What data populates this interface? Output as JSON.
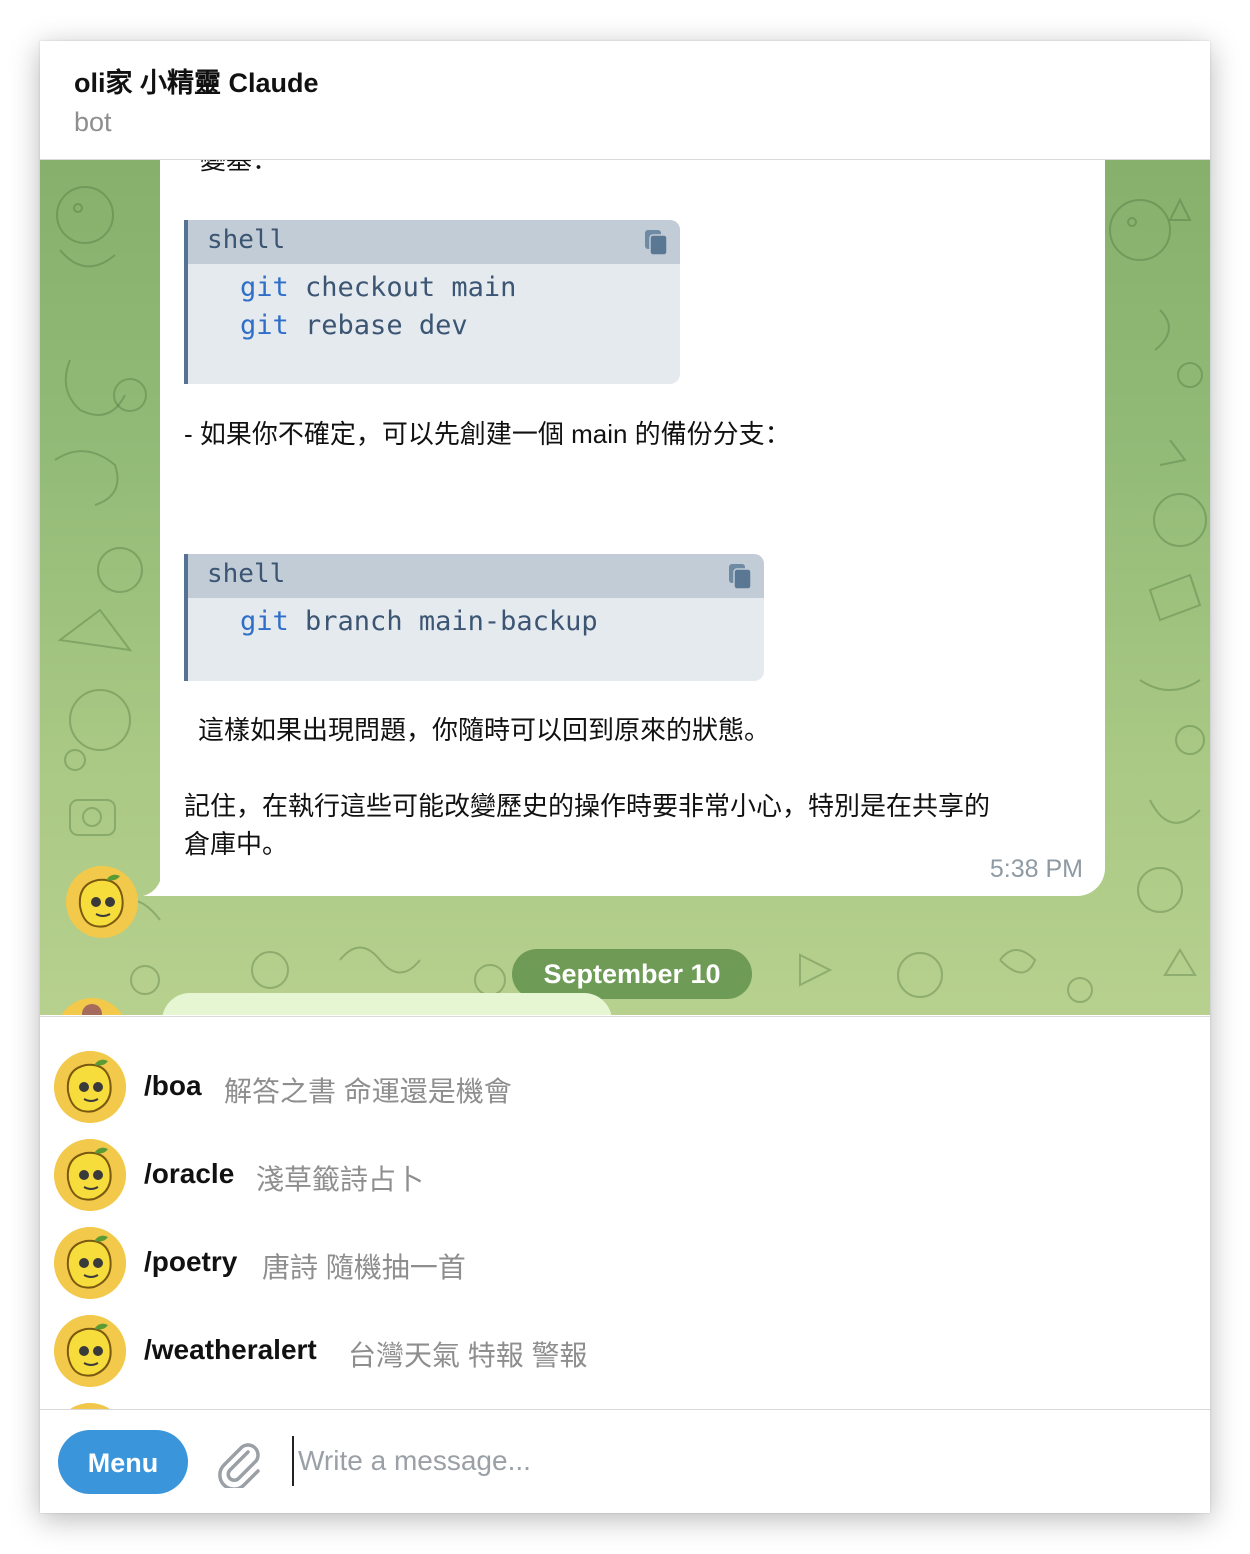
{
  "header": {
    "title": "oli家 小精靈 Claude",
    "subtitle": "bot"
  },
  "message": {
    "cut_line": "變基：",
    "code_blocks": [
      {
        "lang": "shell",
        "lines": [
          [
            "git",
            " checkout main"
          ],
          [
            "git",
            " rebase dev"
          ]
        ]
      },
      {
        "lang": "shell",
        "lines": [
          [
            "git",
            " branch main-backup"
          ]
        ]
      }
    ],
    "paragraph_backup": "- 如果你不確定，可以先創建一個 main 的備份分支：",
    "paragraph_restore": "這樣如果出現問題，你隨時可以回到原來的狀態。",
    "paragraph_warning_1": "記住，在執行這些可能改變歷史的操作時要非常小心，特別是在共享的",
    "paragraph_warning_2": "倉庫中。",
    "time": "5:38 PM"
  },
  "date_separator": "September 10",
  "commands": [
    {
      "name": "/boa",
      "desc": "解答之書 命運還是機會"
    },
    {
      "name": "/oracle",
      "desc": "淺草籤詩占卜"
    },
    {
      "name": "/poetry",
      "desc": "唐詩 隨機抽一首"
    },
    {
      "name": "/weatheralert",
      "desc": "台灣天氣 特報 警報"
    }
  ],
  "composer": {
    "menu_label": "Menu",
    "placeholder": "Write a message..."
  },
  "colors": {
    "accent": "#3a95db",
    "code_header": "#c1ccd6",
    "code_body": "#e5eaef",
    "code_keyword": "#2f6fc7",
    "chat_background": "#93bb78"
  },
  "icons": {
    "copy": "copy-icon",
    "attach": "paperclip-icon",
    "avatar": "lemon-avatar-icon"
  }
}
